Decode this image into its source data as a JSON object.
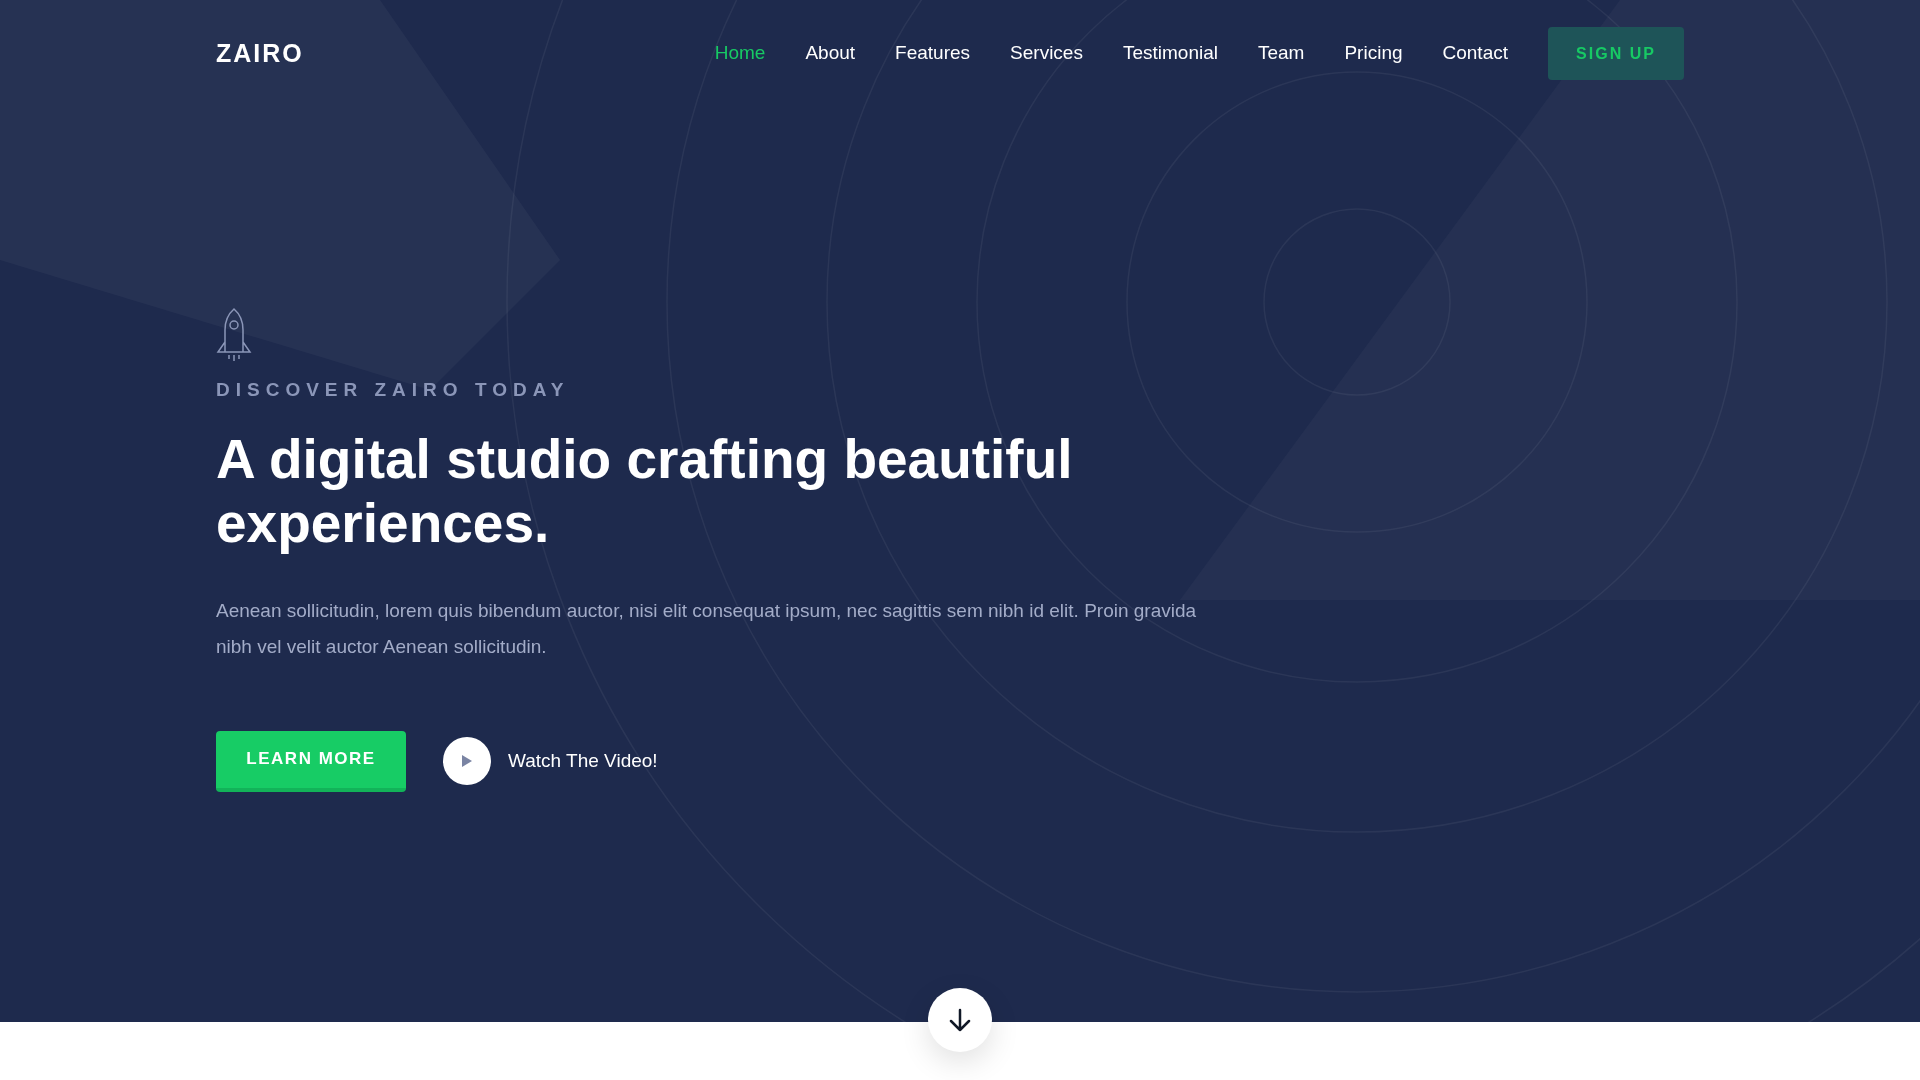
{
  "header": {
    "logo": "ZAIRO",
    "nav": [
      {
        "label": "Home",
        "selected": true
      },
      {
        "label": "About",
        "selected": false
      },
      {
        "label": "Features",
        "selected": false
      },
      {
        "label": "Services",
        "selected": false
      },
      {
        "label": "Testimonial",
        "selected": false
      },
      {
        "label": "Team",
        "selected": false
      },
      {
        "label": "Pricing",
        "selected": false
      },
      {
        "label": "Contact",
        "selected": false
      }
    ],
    "cta": "SIGN UP"
  },
  "hero": {
    "eyebrow": "DISCOVER ZAIRO TODAY",
    "headline": "A digital studio crafting beautiful experiences.",
    "description": "Aenean sollicitudin, lorem quis bibendum auctor, nisi elit consequat ipsum, nec sagittis sem nibh id elit. Proin gravida nibh vel velit auctor Aenean sollicitudin.",
    "primary_button": "LEARN MORE",
    "video_link": "Watch The Video!"
  }
}
